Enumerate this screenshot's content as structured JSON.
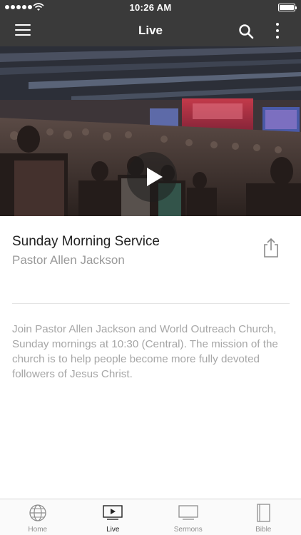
{
  "status_bar": {
    "time": "10:26 AM"
  },
  "nav": {
    "title": "Live"
  },
  "video": {
    "state": "paused"
  },
  "service": {
    "title": "Sunday Morning Service",
    "speaker": "Pastor Allen Jackson",
    "description": "Join Pastor Allen Jackson and World Outreach Church, Sunday mornings at 10:30 (Central). The mission of the church is to help people become more fully devoted followers of Jesus Christ."
  },
  "tabs": [
    {
      "label": "Home",
      "icon": "globe-icon",
      "active": false
    },
    {
      "label": "Live",
      "icon": "play-screen-icon",
      "active": true
    },
    {
      "label": "Sermons",
      "icon": "monitor-icon",
      "active": false
    },
    {
      "label": "Bible",
      "icon": "book-icon",
      "active": false
    }
  ],
  "colors": {
    "bar": "#3a3a3a",
    "text_primary": "#222222",
    "text_secondary": "#9a9a9a"
  }
}
